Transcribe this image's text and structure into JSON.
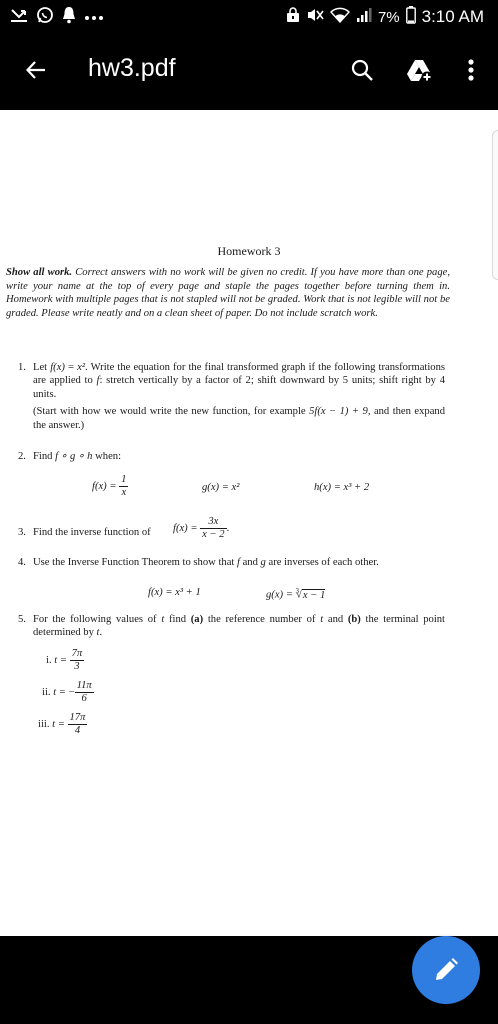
{
  "status_bar": {
    "battery_percent": "7%",
    "time": "3:10 AM",
    "icons": [
      "missed-call-icon",
      "whatsapp-icon",
      "notification-bell-icon",
      "more-notifications-icon",
      "lock-icon",
      "mute-icon",
      "wifi-icon",
      "signal-icon",
      "battery-icon"
    ]
  },
  "app_bar": {
    "title": "hw3.pdf",
    "icons": [
      "back-arrow-icon",
      "search-icon",
      "google-drive-add-icon",
      "more-vertical-icon"
    ]
  },
  "document": {
    "title": "Homework 3",
    "intro_bold": "Show all work.",
    "intro_rest": " Correct answers with no work will be given no credit. If you have more than one page, write your name at the top of every page and staple the pages together before turning them in. Homework with multiple pages that is not stapled will not be graded. Work that is not legible will not be graded. Please write neatly and on a clean sheet of paper. Do not include scratch work.",
    "p1": {
      "num": "1.",
      "a": "Let ",
      "fx": "f(x)",
      "eq": " = ",
      "x2": "x²",
      "b": ". Write the equation for the final transformed graph if the following transformations are applied to ",
      "f": "f",
      "c": ": stretch vertically by a factor of 2; shift downward by 5 units; shift right by 4 units.",
      "note_a": "(Start with how we would write the new function, for example ",
      "note_expr": "5f(x − 1) + 9",
      "note_b": ", and then expand the answer.)"
    },
    "p2": {
      "num": "2.",
      "text_a": "Find ",
      "compose": "f ∘ g ∘ h",
      "text_b": " when:",
      "f_lhs": "f(x) = ",
      "f_num": "1",
      "f_den": "x",
      "g": "g(x) = x²",
      "h": "h(x) = x³ + 2"
    },
    "p3": {
      "num": "3.",
      "text": "Find the inverse function of ",
      "lhs": "f(x) = ",
      "num_expr": "3x",
      "den_expr": "x − 2",
      "end": "."
    },
    "p4": {
      "num": "4.",
      "text_a": "Use the Inverse Function Theorem to show that ",
      "f": "f",
      "text_b": " and ",
      "g": "g",
      "text_c": " are inverses of each other.",
      "f_eq": "f(x) = x³ + 1",
      "g_lhs": "g(x) = ",
      "g_root_index": "3",
      "g_radicand": "x − 1"
    },
    "p5": {
      "num": "5.",
      "text_a": "For the following values of ",
      "t1": "t",
      "text_b": " find ",
      "a_label": "(a)",
      "text_c": " the reference number of ",
      "t2": "t",
      "text_d": " and ",
      "b_label": "(b)",
      "text_e": " the terminal point determined by ",
      "t3": "t",
      "text_f": ".",
      "items": [
        {
          "label": "i.",
          "lhs": "t = ",
          "sign": "",
          "num": "7π",
          "den": "3"
        },
        {
          "label": "ii.",
          "lhs": "t = ",
          "sign": "−",
          "num": "11π",
          "den": "6"
        },
        {
          "label": "iii.",
          "lhs": "t = ",
          "sign": "",
          "num": "17π",
          "den": "4"
        }
      ]
    }
  },
  "fab": {
    "icon": "edit-pencil-icon"
  }
}
